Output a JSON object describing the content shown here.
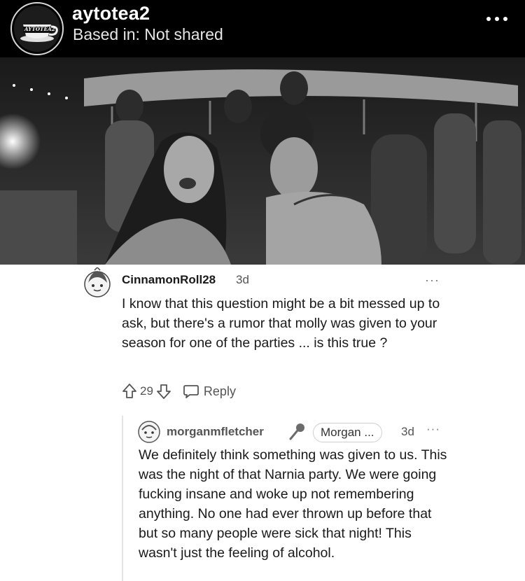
{
  "header": {
    "account_name": "aytotea2",
    "location": "Based in: Not shared",
    "avatar_icon": "teacup-logo-icon",
    "avatar_logo_text": "AYTOTEA2"
  },
  "photo": {
    "description_icon": "party-photo"
  },
  "comment": {
    "username": "CinnamonRoll28",
    "time": "3d",
    "more": "···",
    "text": "I know that this question might be a bit messed up to ask, but there's a rumor that molly was given to your season for one of the parties ... is this true ?",
    "upvotes": "29",
    "reply_label": "Reply"
  },
  "reply": {
    "username": "morganmfletcher",
    "flair": "Morgan ...",
    "time": "3d",
    "more": "···",
    "text": "We definitely think something was given to us. This was the night of that Narnia party. We were going fucking insane and woke up not remembering anything. No one had ever thrown up before that but so many people were sick that night! This wasn't just the feeling of alcohol."
  },
  "colors": {
    "header_bg": "#000000",
    "text_primary": "#1a1a1b",
    "text_secondary": "#555555",
    "thread_line": "#e3e3e3"
  }
}
